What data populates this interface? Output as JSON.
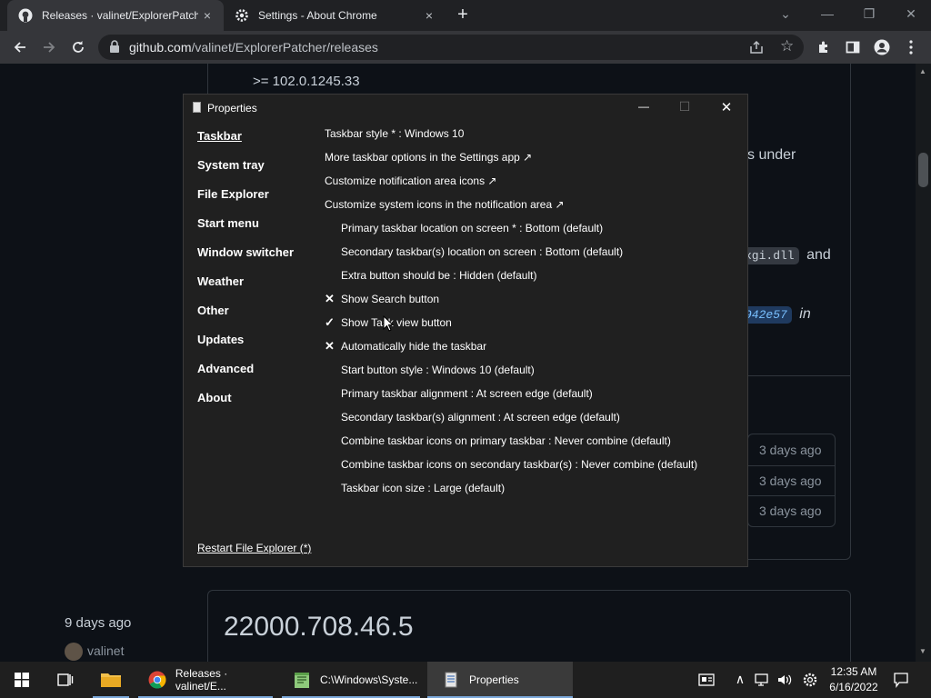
{
  "browser": {
    "tabs": [
      {
        "title": "Releases · valinet/ExplorerPatche",
        "close": "×"
      },
      {
        "title": "Settings - About Chrome",
        "close": "×"
      }
    ],
    "new_tab": "+",
    "window_controls": {
      "dropdown": "⌄",
      "minimize": "—",
      "restore": "❐",
      "close": "✕"
    },
    "url_host": "github.com",
    "url_path": "/valinet/ExplorerPatcher/releases"
  },
  "page": {
    "version_line": ">= 102.0.1245.33",
    "fragment_under": "s under",
    "code_dll": "xgi.dll",
    "and_text": "and",
    "commit_hash": "942e57",
    "in_text": "in",
    "asset_dates": [
      "3 days ago",
      "3 days ago",
      "3 days ago"
    ],
    "release_date": "9 days ago",
    "release_author": "valinet",
    "release_title": "22000.708.46.5"
  },
  "properties": {
    "title": "Properties",
    "controls": {
      "minimize": "—",
      "maximize": "☐",
      "close": "✕"
    },
    "nav": [
      "Taskbar",
      "System tray",
      "File Explorer",
      "Start menu",
      "Window switcher",
      "Weather",
      "Other",
      "Updates",
      "Advanced",
      "About"
    ],
    "options": [
      "Taskbar style * : Windows 10",
      "More taskbar options in the Settings app ↗",
      "Customize notification area icons ↗",
      "Customize system icons in the notification area ↗",
      "Primary taskbar location on screen * : Bottom (default)",
      "Secondary taskbar(s) location on screen : Bottom (default)",
      "Extra button should be : Hidden (default)",
      "Show Search button",
      "Show Task view button",
      "Automatically hide the taskbar",
      "Start button style : Windows 10 (default)",
      "Primary taskbar alignment : At screen edge (default)",
      "Secondary taskbar(s) alignment : At screen edge (default)",
      "Combine taskbar icons on primary taskbar : Never combine (default)",
      "Combine taskbar icons on secondary taskbar(s) : Never combine (default)",
      "Taskbar icon size : Large (default)"
    ],
    "marks": {
      "search": "✕",
      "taskview": "✓",
      "autohide": "✕"
    },
    "restart_link": "Restart File Explorer (*)"
  },
  "taskbar": {
    "items": [
      {
        "label": "Releases · valinet/E..."
      },
      {
        "label": "C:\\Windows\\Syste..."
      },
      {
        "label": "Properties"
      }
    ],
    "tray_chevron": "∧",
    "time": "12:35 AM",
    "date": "6/16/2022"
  },
  "colors": {
    "accent": "#7aa7d9",
    "window_bg": "#202020",
    "page_bg": "#0d1117"
  }
}
